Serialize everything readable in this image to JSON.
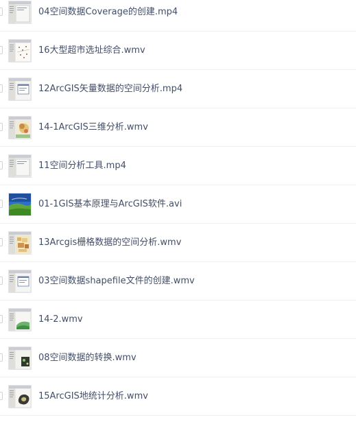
{
  "files": [
    {
      "name": "04空间数据Coverage的创建.mp4",
      "thumb": "window-gray"
    },
    {
      "name": "16大型超市选址综合.wmv",
      "thumb": "map-dots"
    },
    {
      "name": "12ArcGIS矢量数据的空间分析.mp4",
      "thumb": "window-dialog"
    },
    {
      "name": "14-1ArcGIS三维分析.wmv",
      "thumb": "window-map-color"
    },
    {
      "name": "11空间分析工具.mp4",
      "thumb": "window-gray"
    },
    {
      "name": "01-1GIS基本原理与ArcGIS软件.avi",
      "thumb": "landscape"
    },
    {
      "name": "13Arcgis栅格数据的空间分析.wmv",
      "thumb": "map-raster"
    },
    {
      "name": "03空间数据shapefile文件的创建.wmv",
      "thumb": "window-dialog"
    },
    {
      "name": "14-2.wmv",
      "thumb": "window-map-green"
    },
    {
      "name": "08空间数据的转换.wmv",
      "thumb": "window-map-dark"
    },
    {
      "name": "15ArcGIS地统计分析.wmv",
      "thumb": "window-map-blob"
    }
  ]
}
